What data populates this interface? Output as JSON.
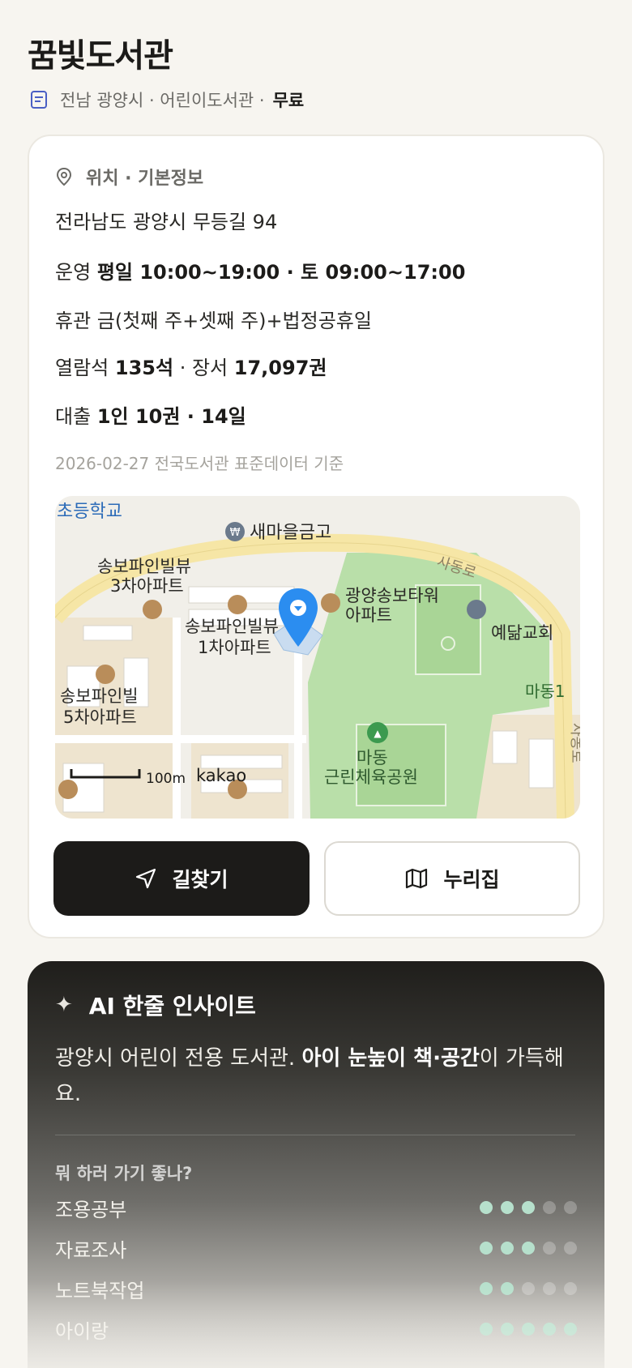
{
  "header": {
    "title": "꿈빛도서관",
    "meta": "전남 광양시 · 어린이도서관 ·",
    "fee": "무료"
  },
  "info": {
    "section_title": "위치 · 기본정보",
    "address": "전라남도 광양시 무등길 94",
    "hours_label": "운영",
    "hours_value": "평일 10:00~19:00 · 토 09:00~17:00",
    "closed": "휴관 금(첫째 주+셋째 주)+법정공휴일",
    "seats_label": "열람석",
    "seats_value": "135석",
    "books_label": "· 장서",
    "books_value": "17,097권",
    "loan_label": "대출",
    "loan_value": "1인 10권 · 14일",
    "source": "2026-02-27 전국도서관 표준데이터 기준"
  },
  "map": {
    "labels": {
      "school": "초등학교",
      "bank": "새마을금고",
      "road_top": "사동로",
      "apt3_l1": "송보파인빌뷰",
      "apt3_l2": "3차아파트",
      "tower_l1": "광양송보타워",
      "tower_l2": "아파트",
      "church": "예닮교회",
      "apt1_l1": "송보파인빌뷰",
      "apt1_l2": "1차아파트",
      "madong": "마동1",
      "apt5_l1": "송보파인빌",
      "apt5_l2": "5차아파트",
      "road_right": "사동로",
      "park_l1": "마동",
      "park_l2": "근린체육공원",
      "scale": "100m",
      "brand": "kakao"
    }
  },
  "actions": {
    "directions": "길찾기",
    "website": "누리집"
  },
  "ai": {
    "title": "AI 한줄 인사이트",
    "text_a": "광양시 어린이 전용 도서관. ",
    "text_b": "아이 눈높이 책·공간",
    "text_c": "이 가득해요.",
    "question": "뭐 하러 가기 좋나?",
    "ratings": [
      {
        "name": "조용공부",
        "score": 3,
        "max": 5
      },
      {
        "name": "자료조사",
        "score": 3,
        "max": 5
      },
      {
        "name": "노트북작업",
        "score": 2,
        "max": 5
      },
      {
        "name": "아이랑",
        "score": 5,
        "max": 5
      }
    ]
  },
  "colors": {
    "dark": "#1c1b19",
    "accent_dot": "#b6e0cc",
    "pin": "#2b8df0"
  }
}
